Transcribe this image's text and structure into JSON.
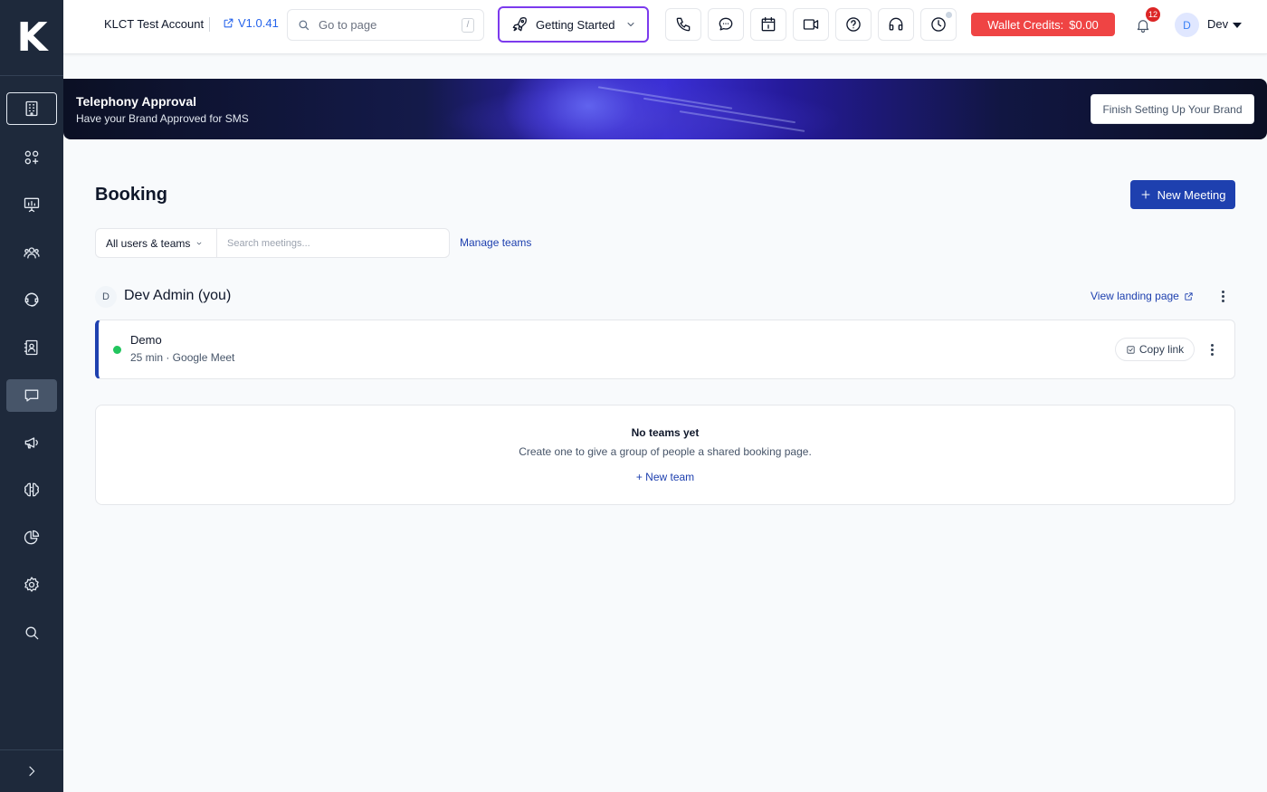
{
  "sidebar": {
    "logo": "K",
    "items": [
      {
        "name": "building-icon"
      },
      {
        "name": "apps-grid-icon"
      },
      {
        "name": "presentation-chart-icon"
      },
      {
        "name": "users-group-icon"
      },
      {
        "name": "support-icon"
      },
      {
        "name": "contact-book-icon"
      },
      {
        "name": "chat-bubble-icon"
      },
      {
        "name": "megaphone-icon"
      },
      {
        "name": "brain-icon"
      },
      {
        "name": "pie-chart-icon"
      },
      {
        "name": "settings-icon"
      },
      {
        "name": "search-icon"
      }
    ],
    "active_item": "chat-bubble-icon",
    "expand_icon": "chevron-right-icon"
  },
  "header": {
    "account_name": "KLCT Test Account",
    "version": "V1.0.41",
    "goto_placeholder": "Go to page",
    "goto_shortcut": "/",
    "getting_started_label": "Getting Started",
    "icon_buttons": [
      "phone-icon",
      "chat-icon",
      "calendar-icon",
      "video-icon",
      "help-icon",
      "headset-icon",
      "clock-icon"
    ],
    "wallet_label": "Wallet Credits:",
    "wallet_amount": "$0.00",
    "notification_count": "12",
    "user_initial": "D",
    "user_name": "Dev"
  },
  "banner": {
    "title": "Telephony Approval",
    "subtitle": "Have your Brand Approved for SMS",
    "button_label": "Finish Setting Up Your Brand"
  },
  "main": {
    "title": "Booking",
    "new_meeting_label": "New Meeting",
    "filter_label": "All users & teams",
    "search_placeholder": "Search meetings...",
    "manage_teams_label": "Manage teams",
    "user_section": {
      "initial": "D",
      "name": "Dev Admin (you)",
      "view_landing_label": "View landing page"
    },
    "meetings": [
      {
        "name": "Demo",
        "meta": "25 min · Google Meet",
        "copy_label": "Copy link",
        "status_color": "#22c55e"
      }
    ],
    "teams_empty": {
      "title": "No teams yet",
      "description": "Create one to give a group of people a shared booking page.",
      "action_label": "+ New team"
    }
  },
  "colors": {
    "sidebar_bg": "#1e293b",
    "primary": "#1e40af",
    "wallet": "#ef4444",
    "accent_border": "#7c3aed"
  }
}
